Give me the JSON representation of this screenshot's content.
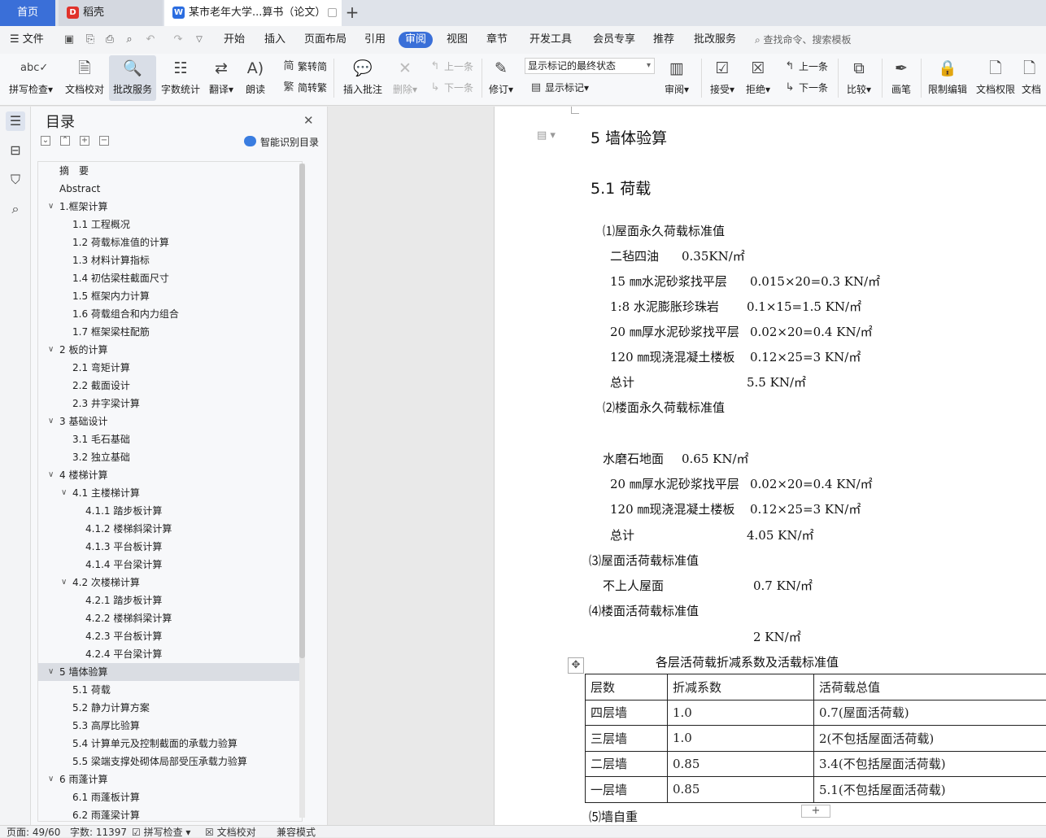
{
  "tabs": {
    "home": "首页",
    "daoke": "稻壳",
    "document": "某市老年大学...算书（论文）",
    "add": "+"
  },
  "menu": {
    "file": "文件",
    "items": [
      "开始",
      "插入",
      "页面布局",
      "引用",
      "审阅",
      "视图",
      "章节",
      "开发工具",
      "会员专享",
      "推荐",
      "批改服务"
    ],
    "active": "审阅",
    "search": "查找命令、搜索模板"
  },
  "ribbon": {
    "spell_check": "拼写检查",
    "doc_proof": "文档校对",
    "review_service": "批改服务",
    "word_count": "字数统计",
    "translate": "翻译",
    "read_aloud": "朗读",
    "trad_to_simp": "繁转简",
    "simp_to_trad": "简转繁",
    "insert_comment": "插入批注",
    "delete": "删除",
    "prev_comment": "上一条",
    "next_comment": "下一条",
    "track_changes": "修订",
    "markup_state": "显示标记的最终状态",
    "show_markup": "显示标记",
    "review": "审阅",
    "accept": "接受",
    "reject": "拒绝",
    "prev_change": "上一条",
    "next_change": "下一条",
    "compare": "比较",
    "pen": "画笔",
    "restrict_edit": "限制编辑",
    "doc_permission": "文档权限",
    "doc_more": "文档"
  },
  "toc": {
    "title": "目录",
    "smart": "智能识别目录",
    "items": [
      {
        "text": "摘　要",
        "level": 0,
        "caret": ""
      },
      {
        "text": "Abstract",
        "level": 0,
        "caret": ""
      },
      {
        "text": "1.框架计算",
        "level": 0,
        "caret": "v"
      },
      {
        "text": "1.1 工程概况",
        "level": 1,
        "caret": ""
      },
      {
        "text": "1.2 荷载标准值的计算",
        "level": 1,
        "caret": ""
      },
      {
        "text": "1.3 材料计算指标",
        "level": 1,
        "caret": ""
      },
      {
        "text": "1.4 初估梁柱截面尺寸",
        "level": 1,
        "caret": ""
      },
      {
        "text": "1.5 框架内力计算",
        "level": 1,
        "caret": ""
      },
      {
        "text": "1.6 荷载组合和内力组合",
        "level": 1,
        "caret": ""
      },
      {
        "text": "1.7 框架梁柱配筋",
        "level": 1,
        "caret": ""
      },
      {
        "text": "2 板的计算",
        "level": 0,
        "caret": "v"
      },
      {
        "text": "2.1 弯矩计算",
        "level": 1,
        "caret": ""
      },
      {
        "text": "2.2 截面设计",
        "level": 1,
        "caret": ""
      },
      {
        "text": "2.3 井字梁计算",
        "level": 1,
        "caret": ""
      },
      {
        "text": "3 基础设计",
        "level": 0,
        "caret": "v"
      },
      {
        "text": "3.1  毛石基础",
        "level": 1,
        "caret": ""
      },
      {
        "text": "3.2 独立基础",
        "level": 1,
        "caret": ""
      },
      {
        "text": "4 楼梯计算",
        "level": 0,
        "caret": "v"
      },
      {
        "text": "4.1 主楼梯计算",
        "level": 1,
        "caret": "v"
      },
      {
        "text": "4.1.1 踏步板计算",
        "level": 2,
        "caret": ""
      },
      {
        "text": "4.1.2 楼梯斜梁计算",
        "level": 2,
        "caret": ""
      },
      {
        "text": "4.1.3 平台板计算",
        "level": 2,
        "caret": ""
      },
      {
        "text": "4.1.4 平台梁计算",
        "level": 2,
        "caret": ""
      },
      {
        "text": "4.2 次楼梯计算",
        "level": 1,
        "caret": "v"
      },
      {
        "text": "4.2.1 踏步板计算",
        "level": 2,
        "caret": ""
      },
      {
        "text": "4.2.2 楼梯斜梁计算",
        "level": 2,
        "caret": ""
      },
      {
        "text": "4.2.3 平台板计算",
        "level": 2,
        "caret": ""
      },
      {
        "text": "4.2.4 平台梁计算",
        "level": 2,
        "caret": ""
      },
      {
        "text": "5 墙体验算",
        "level": 0,
        "caret": "v",
        "selected": true
      },
      {
        "text": "5.1 荷载",
        "level": 1,
        "caret": ""
      },
      {
        "text": "5.2 静力计算方案",
        "level": 1,
        "caret": ""
      },
      {
        "text": "5.3 高厚比验算",
        "level": 1,
        "caret": ""
      },
      {
        "text": "5.4 计算单元及控制截面的承载力验算",
        "level": 1,
        "caret": ""
      },
      {
        "text": "5.5 梁端支撑处砌体局部受压承载力验算",
        "level": 1,
        "caret": ""
      },
      {
        "text": "6 雨蓬计算",
        "level": 0,
        "caret": "v"
      },
      {
        "text": "6.1 雨蓬板计算",
        "level": 1,
        "caret": ""
      },
      {
        "text": "6.2 雨蓬梁计算",
        "level": 1,
        "caret": ""
      }
    ]
  },
  "doc": {
    "h_section": "5 墙体验算",
    "h_sub": "5.1 荷载",
    "roof_dead": "⑴屋面永久荷载标准值",
    "r1_name": "二毡四油",
    "r1_val": "0.35KN/㎡",
    "r2_name": "15 ㎜水泥砂浆找平层",
    "r2_val": "0.015×20=0.3 KN/㎡",
    "r3_name": "1:8 水泥膨胀珍珠岩",
    "r3_val": "0.1×15=1.5 KN/㎡",
    "r4_name": "20 ㎜厚水泥砂浆找平层",
    "r4_val": "0.02×20=0.4 KN/㎡",
    "r5_name": "120 ㎜现浇混凝土楼板",
    "r5_val": "0.12×25=3 KN/㎡",
    "r_total_name": "总计",
    "r_total_val": "5.5 KN/㎡",
    "floor_dead": "⑵楼面永久荷载标准值",
    "f1_name": "水磨石地面",
    "f1_val": "0.65 KN/㎡",
    "f2_name": "20 ㎜厚水泥砂浆找平层",
    "f2_val": "0.02×20=0.4 KN/㎡",
    "f3_name": "120 ㎜现浇混凝土楼板",
    "f3_val": "0.12×25=3 KN/㎡",
    "f_total_name": "总计",
    "f_total_val": "4.05 KN/㎡",
    "roof_live": "⑶屋面活荷载标准值",
    "rl_name": "不上人屋面",
    "rl_val": "0.7 KN/㎡",
    "floor_live": "⑷楼面活荷载标准值",
    "fl_val": "2 KN/㎡",
    "table_caption": "各层活荷载折减系数及活载标准值",
    "table_header": [
      "层数",
      "折减系数",
      "活荷载总值"
    ],
    "table_rows": [
      [
        "四层墙",
        "1.0",
        "0.7(屋面活荷载)"
      ],
      [
        "三层墙",
        "1.0",
        "2(不包括屋面活荷载)"
      ],
      [
        "二层墙",
        "0.85",
        "3.4(不包括屋面活荷载)"
      ],
      [
        "一层墙",
        "0.85",
        "5.1(不包括屋面活荷载)"
      ]
    ],
    "self_weight": "⑸墙自重"
  },
  "status": {
    "page": "页面: 49/60",
    "words": "字数: 11397",
    "spell": "拼写检查",
    "proof": "文档校对",
    "compat": "兼容模式"
  }
}
